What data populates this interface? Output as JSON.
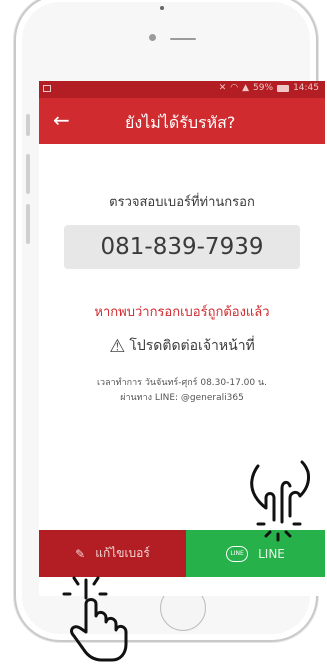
{
  "statusbar": {
    "signal_text": "59%",
    "time": "14:45"
  },
  "appbar": {
    "back_label": "←",
    "title": "ยังไม่ได้รับรหัส?"
  },
  "content": {
    "check_prompt": "ตรวจสอบเบอร์ที่ท่านกรอก",
    "phone_number": "081-839-7939",
    "correct_text": "หากพบว่ากรอกเบอร์ถูกต้องแล้ว",
    "contact_text": "โปรดติดต่อเจ้าหน้าที่",
    "hours_line1": "เวลาทำการ วันจันทร์-ศุกร์ 08.30-17.00 น.",
    "hours_line2": "ผ่านทาง LINE: @generali365"
  },
  "buttons": {
    "edit_label": "แก้ไขเบอร์",
    "line_badge": "LINE",
    "line_label": "LINE"
  },
  "colors": {
    "primary_red": "#d02b2f",
    "dark_red": "#b21e23",
    "line_green": "#26b14a"
  },
  "icons": [
    "back-arrow-icon",
    "warning-icon",
    "pencil-icon",
    "line-icon",
    "hand-pointer-icon"
  ]
}
